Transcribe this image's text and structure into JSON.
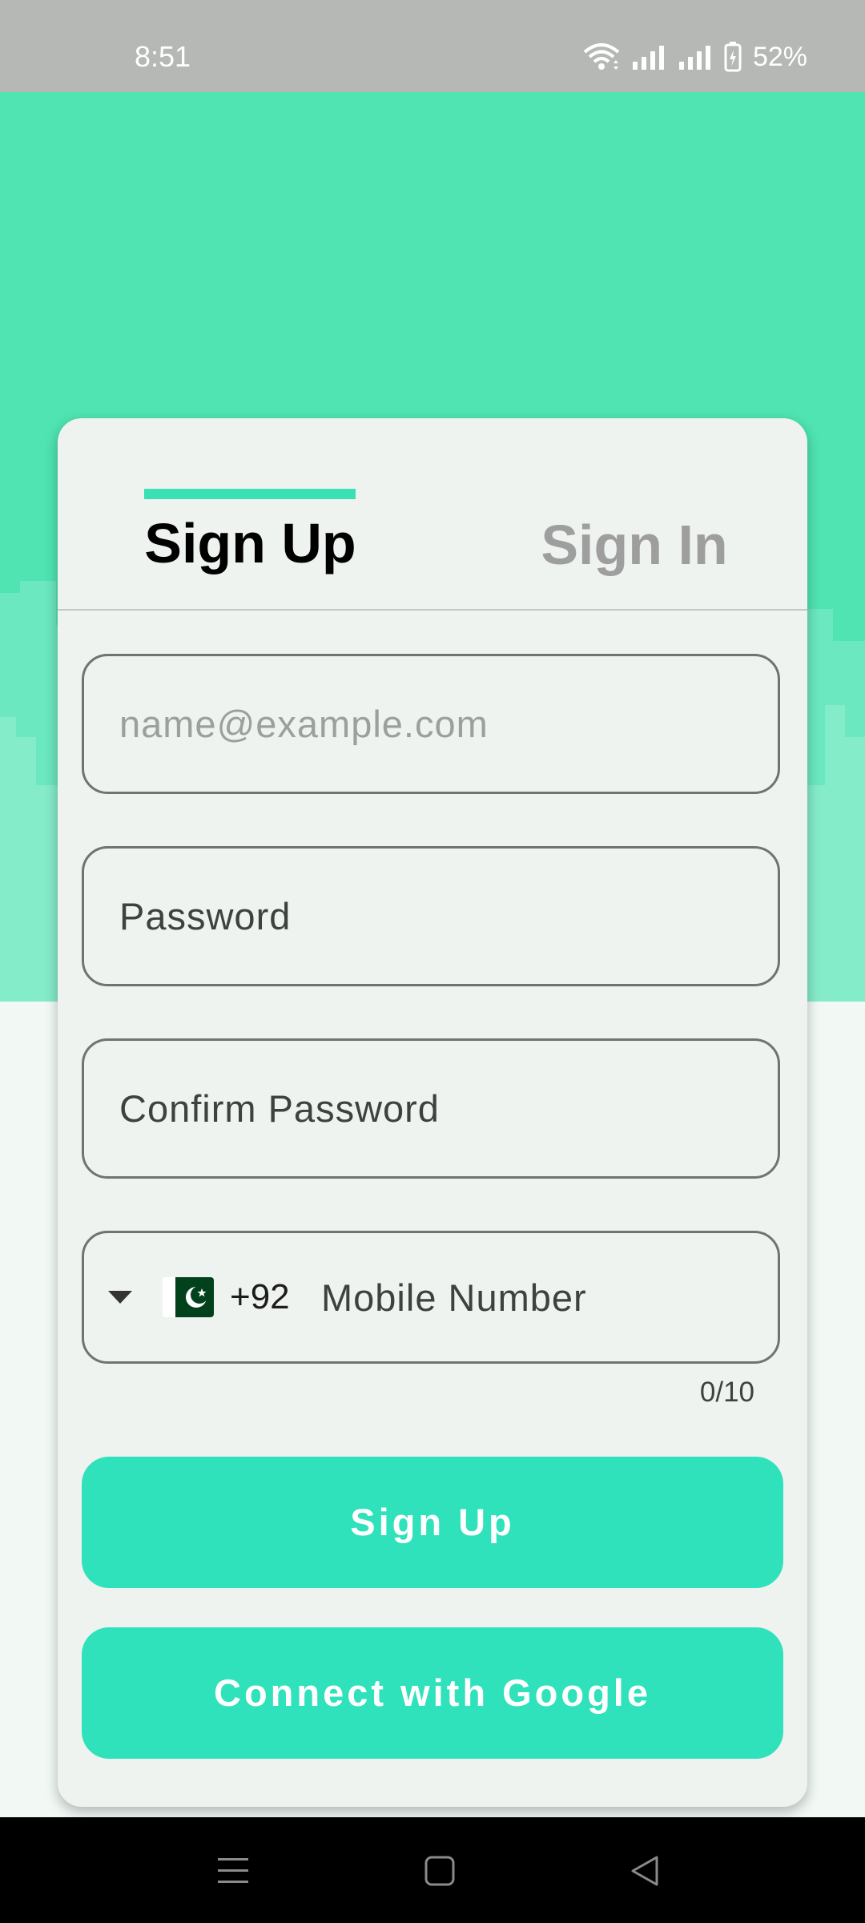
{
  "status_bar": {
    "time": "8:51",
    "battery": "52%",
    "icons": [
      "wifi-icon",
      "signal-icon",
      "signal-icon",
      "battery-icon"
    ]
  },
  "colors": {
    "accent": "#2fe2bb",
    "hero": "#4fe4b2",
    "card": "#eff3f0"
  },
  "tabs": {
    "signup": "Sign Up",
    "signin": "Sign In",
    "active": "signup"
  },
  "form": {
    "email_placeholder": "name@example.com",
    "password_placeholder": "Password",
    "confirm_placeholder": "Confirm Password",
    "phone": {
      "country_flag": "pakistan-flag-icon",
      "country_code": "+92",
      "placeholder": "Mobile Number",
      "counter": "0/10"
    }
  },
  "buttons": {
    "signup": "Sign Up",
    "google": "Connect with Google"
  },
  "nav_bar": {
    "icons": [
      "menu-icon",
      "home-icon",
      "back-icon"
    ]
  }
}
